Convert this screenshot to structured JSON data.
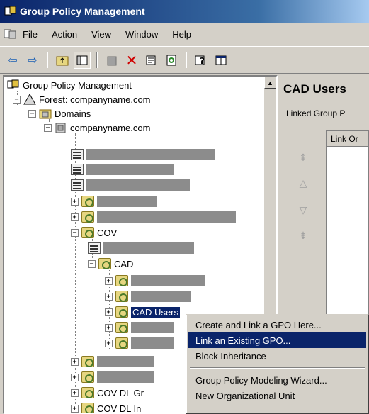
{
  "window": {
    "title": "Group Policy Management"
  },
  "menubar": {
    "items": [
      "File",
      "Action",
      "View",
      "Window",
      "Help"
    ]
  },
  "toolbar": {
    "buttons": [
      "back-icon",
      "forward-icon",
      "up-folder-icon",
      "show-hide-tree-icon",
      "paste-icon",
      "delete-icon",
      "properties-icon",
      "refresh-icon",
      "help-icon",
      "export-list-icon"
    ]
  },
  "tree": {
    "root": "Group Policy Management",
    "forest": "Forest:  companyname.com",
    "domains": "Domains",
    "domain": "companyname.com",
    "cov": "COV",
    "cad": "CAD",
    "cad_users": "CAD Users",
    "cov_dl_gr": "COV DL Gr",
    "cov_dl_in": "COV DL In"
  },
  "right_pane": {
    "title": "CAD Users",
    "tab": "Linked Group P",
    "column_header": "Link Or"
  },
  "context_menu": {
    "items": [
      "Create and Link a GPO Here...",
      "Link an Existing GPO...",
      "Block Inheritance",
      "Group Policy Modeling Wizard...",
      "New Organizational Unit"
    ],
    "highlighted_index": 1
  }
}
